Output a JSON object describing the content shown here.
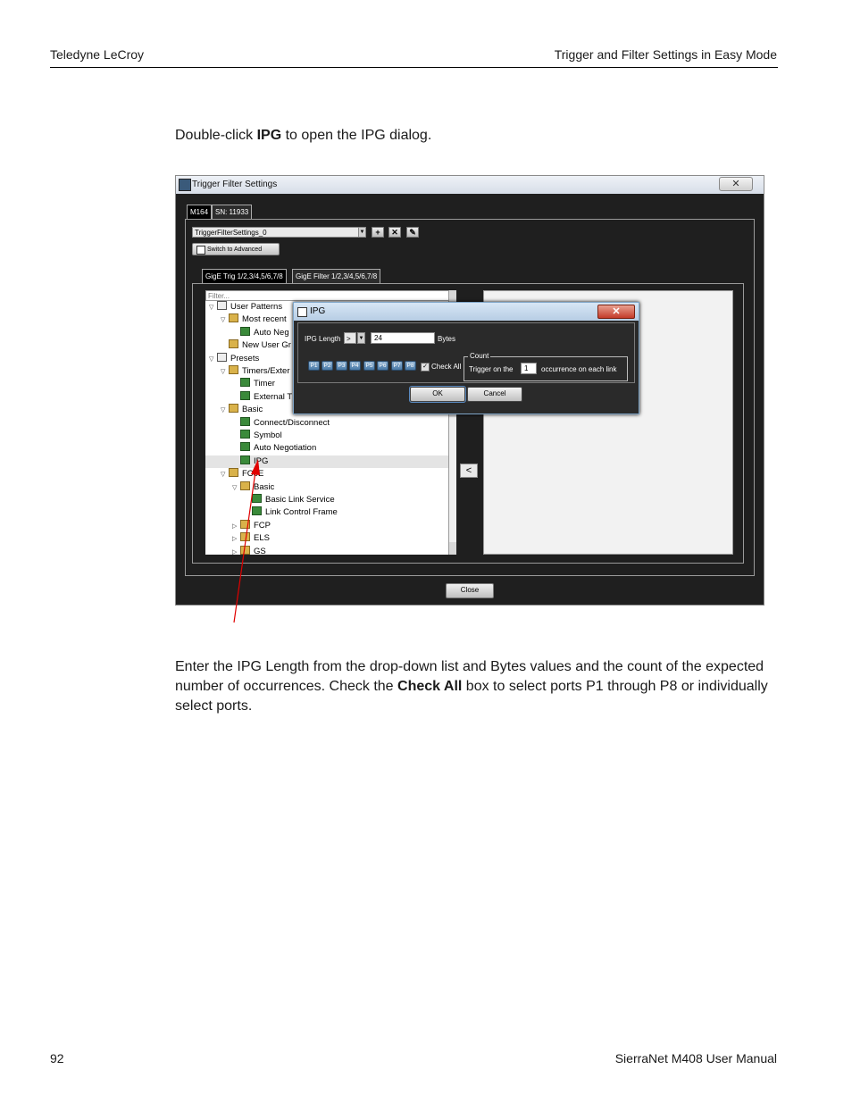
{
  "header": {
    "left": "Teledyne LeCroy",
    "right": "Trigger and Filter Settings in Easy Mode"
  },
  "footer": {
    "page_number": "92",
    "manual": "SierraNet M408 User Manual"
  },
  "intro": {
    "before": "Double-click ",
    "bold": "IPG",
    "after": " to open the IPG dialog."
  },
  "body_text": {
    "part1": "Enter the IPG Length from the drop-down list and Bytes values and the count of the expected number of occurrences. Check the ",
    "bold": "Check All",
    "part2": " box to select ports P1 through P8 or individually select ports."
  },
  "window": {
    "title": "Trigger Filter Settings",
    "close_glyph": "✕",
    "device_tab": "M164",
    "serial_tab": "SN: 11933",
    "combo_value": "TriggerFilterSettings_0",
    "add_glyph": "+",
    "delete_glyph": "✕",
    "edit_glyph": "✎",
    "switch_button": "Switch to Advanced",
    "tabs": [
      "GigE Trig 1/2,3/4,5/6,7/8",
      "GigE Filter 1/2,3/4,5/6,7/8"
    ],
    "filter_placeholder": "Filter...",
    "move_glyph": "<",
    "close_button": "Close",
    "tree": [
      {
        "label": "User Patterns",
        "twisty": "▽",
        "icon": "list"
      },
      {
        "label": "Most recent",
        "twisty": "▽",
        "icon": "folder"
      },
      {
        "label": "Auto Neg",
        "twisty": "",
        "icon": "pat"
      },
      {
        "label": "New User Gr",
        "twisty": "",
        "icon": "folder"
      },
      {
        "label": "Presets",
        "twisty": "▽",
        "icon": "list"
      },
      {
        "label": "Timers/Exter",
        "twisty": "▽",
        "icon": "folder"
      },
      {
        "label": "Timer",
        "twisty": "",
        "icon": "pat"
      },
      {
        "label": "External T",
        "twisty": "",
        "icon": "pat"
      },
      {
        "label": "Basic",
        "twisty": "▽",
        "icon": "folder"
      },
      {
        "label": "Connect/Disconnect",
        "twisty": "",
        "icon": "pat"
      },
      {
        "label": "Symbol",
        "twisty": "",
        "icon": "pat"
      },
      {
        "label": "Auto Negotiation",
        "twisty": "",
        "icon": "pat"
      },
      {
        "label": "IPG",
        "twisty": "",
        "icon": "pat"
      },
      {
        "label": "FCoE",
        "twisty": "▽",
        "icon": "folder"
      },
      {
        "label": "Basic",
        "twisty": "▽",
        "icon": "folder"
      },
      {
        "label": "Basic Link Service",
        "twisty": "",
        "icon": "pat"
      },
      {
        "label": "Link Control Frame",
        "twisty": "",
        "icon": "pat"
      },
      {
        "label": "FCP",
        "twisty": "▷",
        "icon": "folder"
      },
      {
        "label": "ELS",
        "twisty": "▷",
        "icon": "folder"
      },
      {
        "label": "GS",
        "twisty": "▷",
        "icon": "folder"
      }
    ]
  },
  "ipg_dialog": {
    "title": "IPG",
    "close_glyph": "✕",
    "length_label": "IPG Length",
    "operator": ">",
    "length_value": "24",
    "units": "Bytes",
    "ports": [
      "P1",
      "P2",
      "P3",
      "P4",
      "P5",
      "P6",
      "P7",
      "P8"
    ],
    "check_mark": "✓",
    "check_all": "Check All",
    "count_group": "Count",
    "trigger_prefix": "Trigger on the",
    "count_value": "1",
    "trigger_suffix": "occurrence on each link",
    "ok": "OK",
    "cancel": "Cancel"
  }
}
